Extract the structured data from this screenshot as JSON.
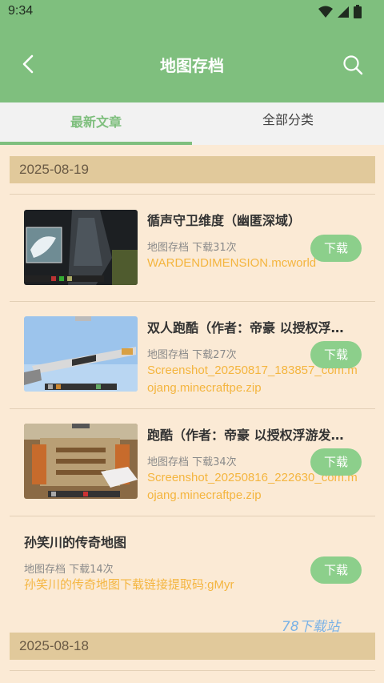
{
  "status": {
    "time": "9:34"
  },
  "header": {
    "title": "地图存档"
  },
  "tabs": [
    {
      "label": "最新文章"
    },
    {
      "label": "全部分类"
    }
  ],
  "groups": [
    {
      "date": "2025-08-19"
    },
    {
      "date": "2025-08-18"
    }
  ],
  "items": [
    {
      "title": "循声守卫维度（幽匿深域）",
      "meta": "地图存档   下载31次",
      "file": "WARDENDIMENSION.mcworld",
      "button": "下载"
    },
    {
      "title": "双人跑酷（作者：帝豪 以授权浮游发布）",
      "meta": "地图存档   下载27次",
      "file": "Screenshot_20250817_183857_com.mojang.minecraftpe.zip",
      "button": "下载"
    },
    {
      "title": "跑酷（作者：帝豪 以授权浮游发布）",
      "meta": "地图存档   下载34次",
      "file": "Screenshot_20250816_222630_com.mojang.minecraftpe.zip",
      "button": "下载"
    },
    {
      "title": "孙笑川的传奇地图",
      "meta": "地图存档   下载14次",
      "file": "孙笑川的传奇地图下载链接提取码:gMyr",
      "button": "下载"
    }
  ],
  "watermark": "78下载站",
  "colors": {
    "accent": "#7fbf7e",
    "background": "#fbead5",
    "file_link": "#f4b53f",
    "date_bar": "#e1c99b"
  }
}
